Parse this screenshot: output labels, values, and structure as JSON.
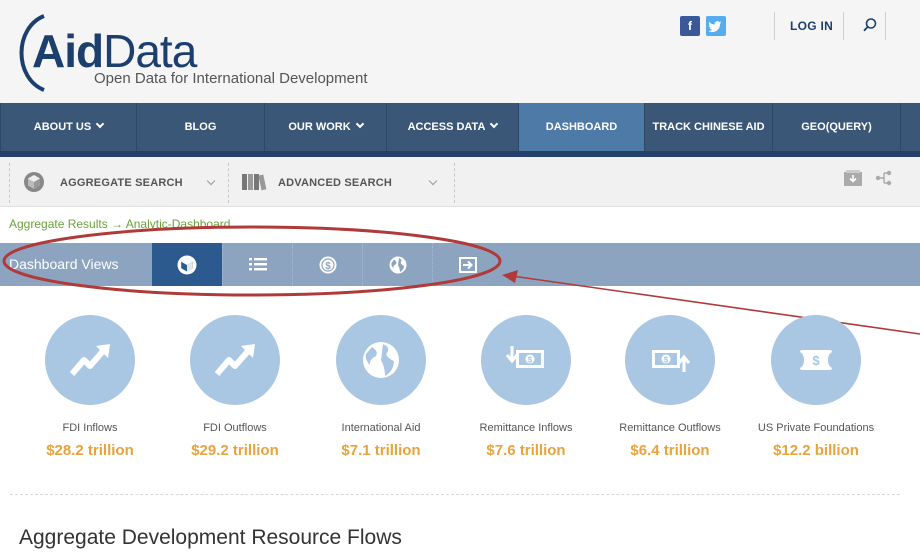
{
  "brand": {
    "name_bold": "Aid",
    "name_light": "Data",
    "tagline": "Open Data for International Development"
  },
  "header": {
    "social": [
      {
        "label": "f",
        "icon": "facebook-icon",
        "color": "#3b5998"
      },
      {
        "label": "t",
        "icon": "twitter-icon",
        "color": "#55acee"
      }
    ],
    "login_label": "LOG IN"
  },
  "nav": {
    "items": [
      {
        "label": "ABOUT US",
        "dropdown": true
      },
      {
        "label": "BLOG",
        "dropdown": false
      },
      {
        "label": "OUR WORK",
        "dropdown": true
      },
      {
        "label": "ACCESS DATA",
        "dropdown": true
      },
      {
        "label": "DASHBOARD",
        "dropdown": false,
        "active": true
      },
      {
        "label": "TRACK CHINESE AID",
        "dropdown": false
      },
      {
        "label": "GEO(QUERY)",
        "dropdown": false
      }
    ]
  },
  "toolbar": {
    "aggregate_label": "AGGREGATE SEARCH",
    "advanced_label": "ADVANCED SEARCH"
  },
  "breadcrumb": "Aggregate Results → Analytic-Dashboard",
  "views": {
    "label": "Dashboard Views",
    "buttons": [
      "cube-icon",
      "list-icon",
      "coin-icon",
      "globe-icon",
      "export-icon"
    ],
    "active_index": 0
  },
  "stats": [
    {
      "label": "FDI Inflows",
      "value": "$28.2 trillion",
      "icon": "trend-up-icon"
    },
    {
      "label": "FDI Outflows",
      "value": "$29.2 trillion",
      "icon": "trend-up-icon"
    },
    {
      "label": "International Aid",
      "value": "$7.1 trillion",
      "icon": "globe-icon"
    },
    {
      "label": "Remittance Inflows",
      "value": "$7.6 trillion",
      "icon": "money-in-icon"
    },
    {
      "label": "Remittance Outflows",
      "value": "$6.4 trillion",
      "icon": "money-out-icon"
    },
    {
      "label": "US Private Foundations",
      "value": "$12.2 billion",
      "icon": "dollar-bill-icon"
    }
  ],
  "section_title": "Aggregate Development Resource Flows",
  "colors": {
    "nav_bg": "#3b5778",
    "nav_active": "#4e7aa8",
    "views_bg": "#8da4c0",
    "views_active": "#2c5a8f",
    "stat_circle": "#a9c6e3",
    "stat_value": "#e8a33c",
    "breadcrumb": "#6aa23a",
    "annotation": "#c0392b"
  }
}
